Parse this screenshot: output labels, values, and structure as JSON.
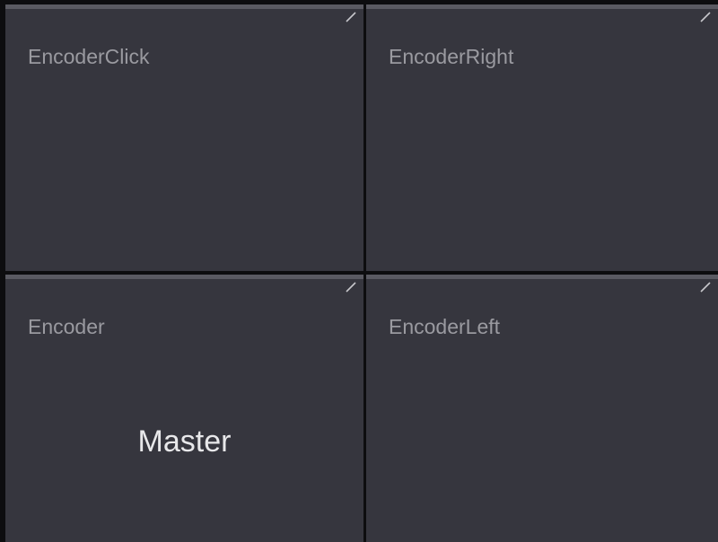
{
  "tiles": [
    {
      "title": "EncoderClick",
      "value": ""
    },
    {
      "title": "EncoderRight",
      "value": ""
    },
    {
      "title": "Encoder",
      "value": "Master"
    },
    {
      "title": "EncoderLeft",
      "value": ""
    }
  ],
  "icons": {
    "edit": "edit-pencil-icon"
  },
  "colors": {
    "background": "#0d0d0f",
    "tile": "#36363e",
    "tile_top_bar": "#5a5a62",
    "title_text": "#9a9aa0",
    "value_text": "#e8e8ea"
  }
}
